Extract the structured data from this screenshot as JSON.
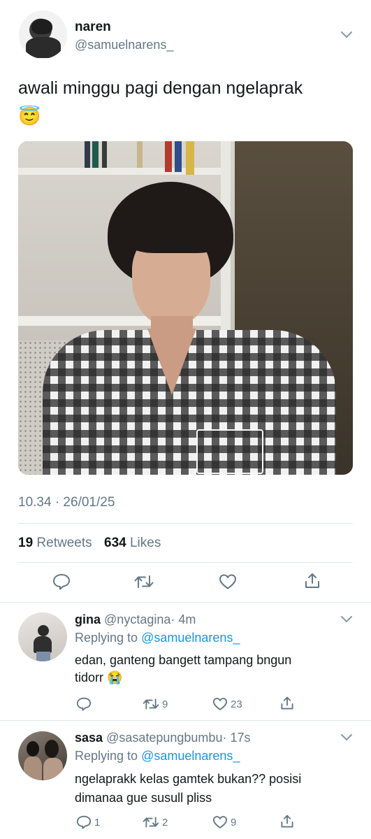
{
  "tweet": {
    "name": "naren",
    "handle": "@samuelnarens_",
    "text": "awali minggu pagi dengan ngelaprak",
    "emoji": "😇",
    "timestamp": "10.34 · 26/01/25",
    "retweets_count": "19",
    "retweets_label": "Retweets",
    "likes_count": "634",
    "likes_label": "Likes"
  },
  "replies": [
    {
      "name": "gina",
      "handle": "@nyctagina",
      "time": "· 4m",
      "replying_label": "Replying to",
      "replying_to": "@samuelnarens_",
      "text_line1": "edan, ganteng bangett tampang bngun",
      "text_line2": "tidorr",
      "emoji": "😭",
      "reply_count": "",
      "retweet_count": "9",
      "like_count": "23"
    },
    {
      "name": "sasa",
      "handle": "@sasatepungbumbu",
      "time": "· 17s",
      "replying_label": "Replying to",
      "replying_to": "@samuelnarens_",
      "text_line1": "ngelaprakk kelas gamtek bukan?? posisi",
      "text_line2": "dimanaa gue susull pliss",
      "emoji": "",
      "reply_count": "1",
      "retweet_count": "2",
      "like_count": "9"
    }
  ],
  "colors": {
    "link": "#1b95e0",
    "secondary": "#657786",
    "divider": "#e1e8ed",
    "text": "#14171a"
  }
}
